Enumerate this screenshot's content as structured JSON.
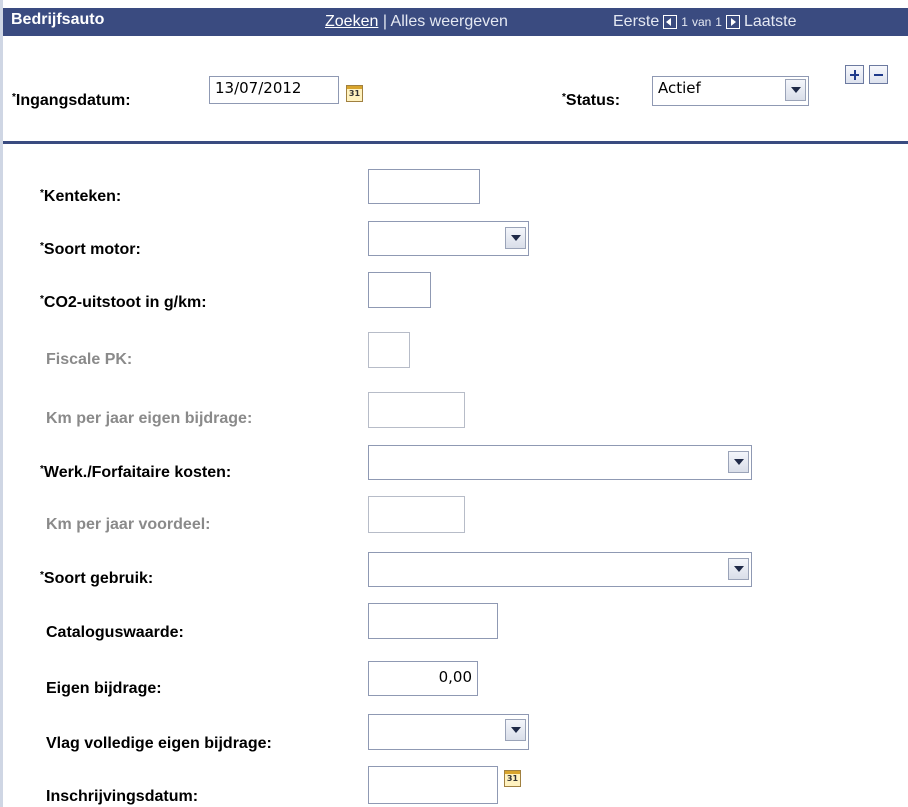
{
  "header": {
    "title": "Bedrijfsauto",
    "search_link": "Zoeken",
    "separator": " | ",
    "view_all": "Alles weergeven",
    "first": "Eerste",
    "page_current": "1",
    "page_of": "van",
    "page_total": "1",
    "last": "Laatste"
  },
  "top": {
    "req": "*",
    "start_date_label": "Ingangsdatum:",
    "start_date_value": "13/07/2012",
    "status_label": "Status:",
    "status_value": "Actief"
  },
  "fields": {
    "req": "*",
    "kenteken": "Kenteken:",
    "soort_motor": "Soort motor:",
    "co2": "CO2-uitstoot in g/km:",
    "fiscale_pk": "Fiscale PK:",
    "km_eigen": "Km per jaar eigen bijdrage:",
    "werk_kosten": "Werk./Forfaitaire kosten:",
    "km_voordeel": "Km per jaar voordeel:",
    "soort_gebruik": "Soort gebruik:",
    "catalogus": "Cataloguswaarde:",
    "eigen_bijdrage": "Eigen bijdrage:",
    "eigen_bijdrage_value": "0,00",
    "vlag": "Vlag volledige eigen bijdrage:",
    "inschrijving": "Inschrijvingsdatum:"
  },
  "icons": {
    "calendar": "calendar-icon",
    "dropdown": "chevron-down-icon",
    "add": "plus-icon",
    "remove": "minus-icon",
    "prev": "arrow-left-icon",
    "next": "arrow-right-icon"
  },
  "colors": {
    "header_bg": "#3a4b80",
    "divider": "#3a4b80",
    "disabled_text": "#8a8a8a"
  }
}
